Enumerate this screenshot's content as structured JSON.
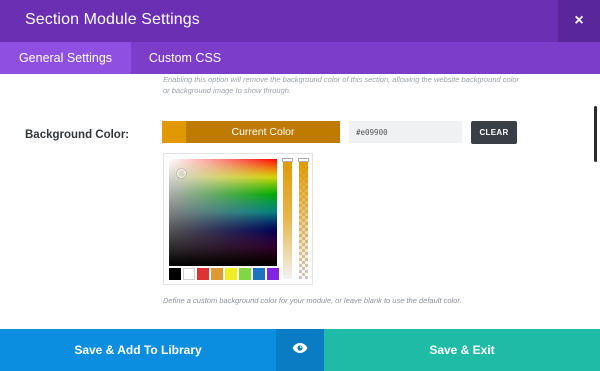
{
  "header": {
    "title": "Section Module Settings",
    "close_glyph": "×"
  },
  "tabs": [
    {
      "label": "General Settings",
      "active": true
    },
    {
      "label": "Custom CSS",
      "active": false
    }
  ],
  "content": {
    "faded_description": "Enabling this option will remove the background color of this section, allowing the website background color or background image to show through.",
    "background_color": {
      "label": "Background Color:",
      "current_color_label": "Current Color",
      "hex_value": "#e09900",
      "clear_label": "CLEAR",
      "swatch_color": "#e09900",
      "button_color": "#bf7a00"
    },
    "palette": [
      "#000000",
      "#ffffff",
      "#dd3333",
      "#dd9933",
      "#eeee22",
      "#81d742",
      "#1e73be",
      "#8224e3"
    ],
    "help_text": "Define a custom background color for your module, or leave blank to use the default color."
  },
  "footer": {
    "save_library_label": "Save & Add To Library",
    "preview_icon": "eye-icon",
    "save_exit_label": "Save & Exit"
  },
  "colors": {
    "header": "#6b2fb3",
    "tabs": "#7d3dcb",
    "active_tab": "#8f4fe0",
    "library_button": "#0c8ee0",
    "exit_button": "#1fbba6"
  }
}
